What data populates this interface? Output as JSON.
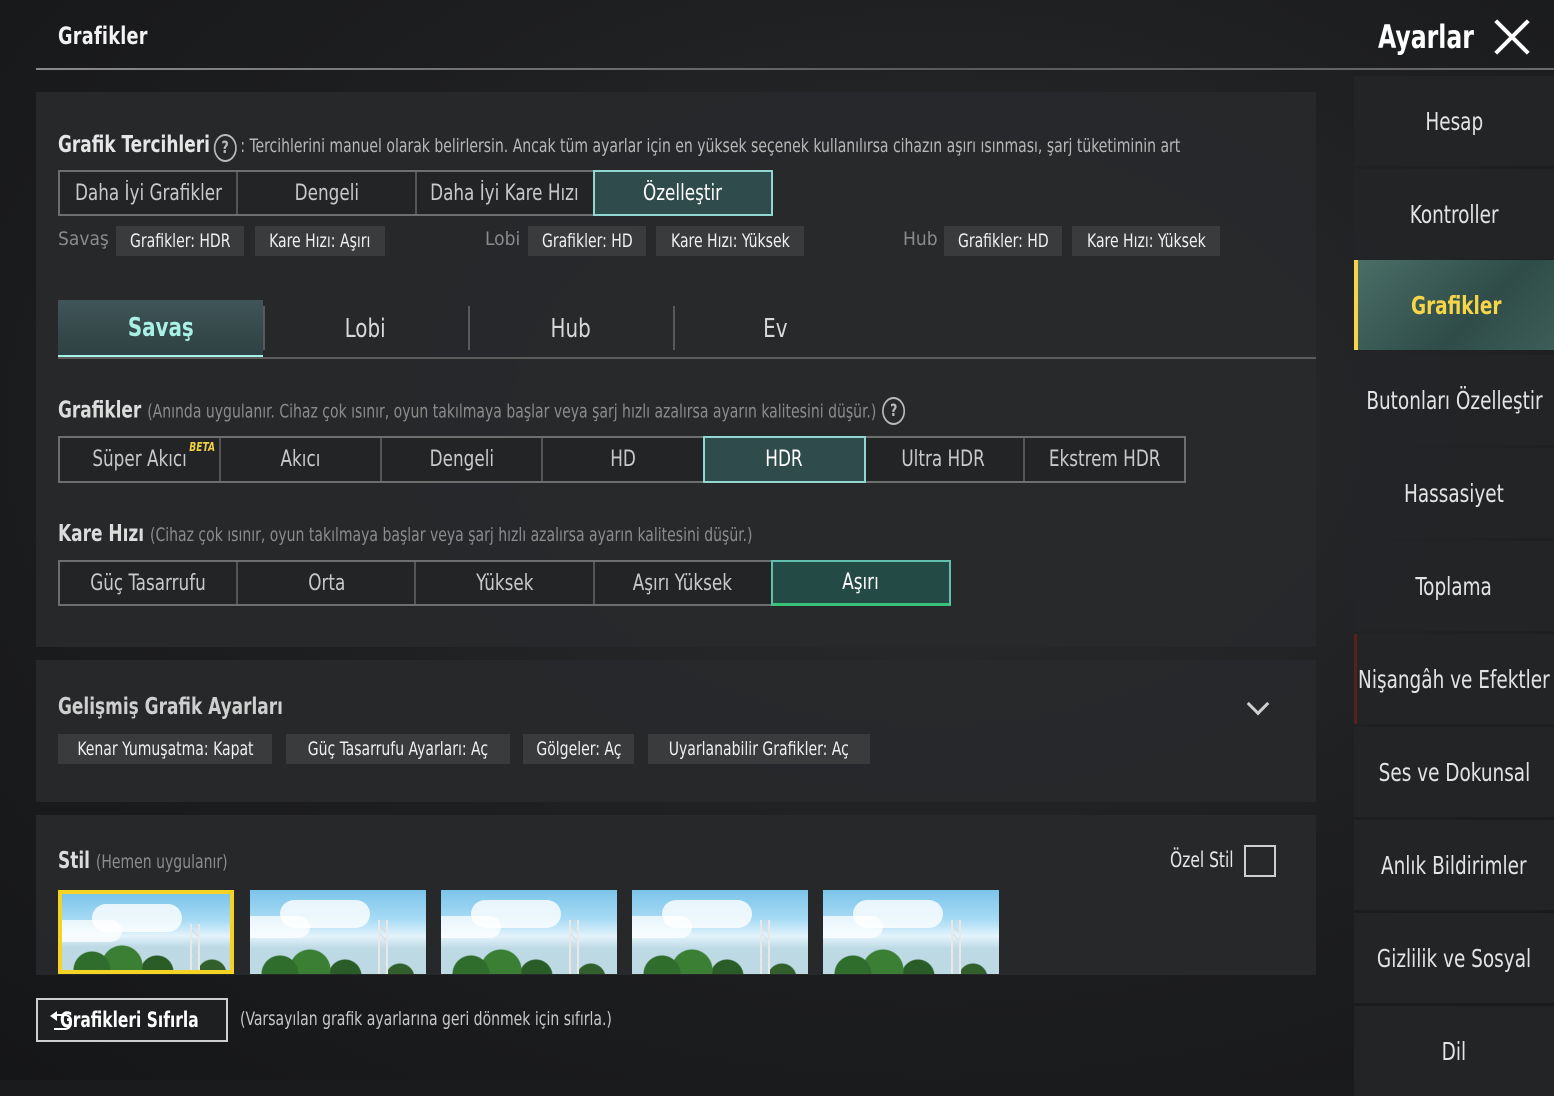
{
  "header": {
    "section_title": "Grafikler",
    "app_title": "Ayarlar",
    "close_icon": "close-icon"
  },
  "preferences": {
    "label": "Grafik Tercihleri",
    "description": ": Tercihlerini manuel olarak belirlersin. Ancak tüm ayarlar için en yüksek seçenek kullanılırsa cihazın aşırı ısınması, şarj tüketiminin art",
    "options": [
      "Daha İyi Grafikler",
      "Dengeli",
      "Daha İyi Kare Hızı",
      "Özelleştir"
    ],
    "selected": "Özelleştir"
  },
  "presets": {
    "savas_label": "Savaş",
    "savas_graphics": "Grafikler: HDR",
    "savas_fps": "Kare Hızı: Aşırı",
    "lobi_label": "Lobi",
    "lobi_graphics": "Grafikler: HD",
    "lobi_fps": "Kare Hızı: Yüksek",
    "hub_label": "Hub",
    "hub_graphics": "Grafikler: HD",
    "hub_fps": "Kare Hızı: Yüksek"
  },
  "mode_tabs": {
    "items": [
      "Savaş",
      "Lobi",
      "Hub",
      "Ev"
    ],
    "selected": "Savaş"
  },
  "graphics": {
    "label": "Grafikler",
    "note": "(Anında uygulanır. Cihaz çok ısınır, oyun takılmaya başlar veya şarj hızlı azalırsa ayarın kalitesini düşür.)",
    "options": [
      "Süper Akıcı",
      "Akıcı",
      "Dengeli",
      "HD",
      "HDR",
      "Ultra HDR",
      "Ekstrem HDR"
    ],
    "beta_badge": "BETA",
    "selected": "HDR"
  },
  "frame_rate": {
    "label": "Kare Hızı",
    "note": "(Cihaz çok ısınır, oyun takılmaya başlar veya şarj hızlı azalırsa ayarın kalitesini düşür.)",
    "options": [
      "Güç Tasarrufu",
      "Orta",
      "Yüksek",
      "Aşırı Yüksek",
      "Aşırı"
    ],
    "selected": "Aşırı"
  },
  "advanced": {
    "title": "Gelişmiş Grafik Ayarları",
    "chips": [
      "Kenar Yumuşatma: Kapat",
      "Güç Tasarrufu Ayarları: Aç",
      "Gölgeler: Aç",
      "Uyarlanabilir Grafikler: Aç"
    ]
  },
  "style": {
    "title": "Stil",
    "note": "(Hemen uygulanır)",
    "custom_label": "Özel Stil",
    "custom_checked": false,
    "thumbnail_count": 5,
    "selected_index": 0
  },
  "reset": {
    "button_label": "Grafikleri Sıfırla",
    "note": "(Varsayılan grafik ayarlarına geri dönmek için sıfırla.)"
  },
  "sidebar": {
    "items": [
      "Hesap",
      "Kontroller",
      "Grafikler",
      "Butonları Özelleştir",
      "Hassasiyet",
      "Toplama",
      "Nişangâh ve Efektler",
      "Ses ve Dokunsal",
      "Anlık Bildirimler",
      "Gizlilik ve Sosyal",
      "Dil"
    ],
    "selected": "Grafikler"
  },
  "colors": {
    "accent_teal": "#8fd7d0",
    "accent_yellow": "#f6d648",
    "accent_green": "#39c27a"
  }
}
